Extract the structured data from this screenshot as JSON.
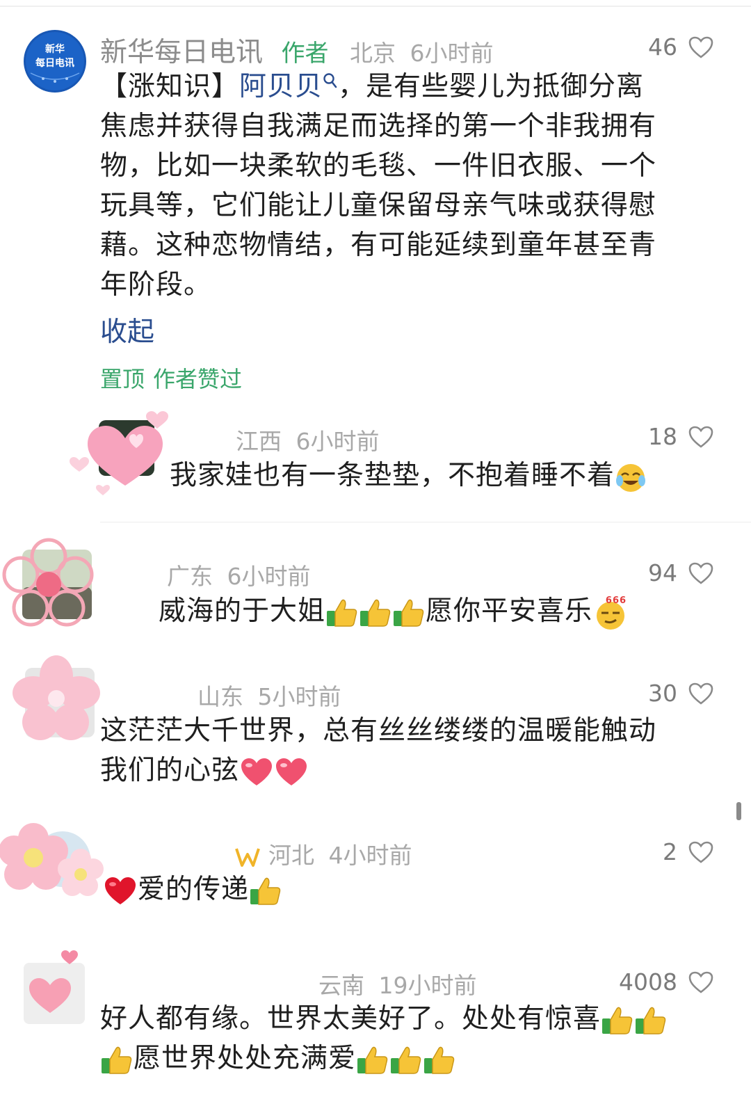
{
  "comments": [
    {
      "name": "新华每日电讯",
      "author_tag": "作者",
      "location": "北京",
      "time": "6小时前",
      "likes": "46",
      "text_prefix": "【涨知识】",
      "link_text": "阿贝贝",
      "text_l1_rest": "，是有些婴儿为抵御分离",
      "text_l2": "焦虑并获得自我满足而选择的第一个非我拥有",
      "text_l3": "物，比如一块柔软的毛毯、一件旧衣服、一个",
      "text_l4": "玩具等，它们能让儿童保留母亲气味或获得慰",
      "text_l5": "藉。这种恋物情结，有可能延续到童年甚至青",
      "text_l6": "年阶段。",
      "collapse_label": "收起",
      "tag_pinned": "置顶",
      "tag_liked": "作者赞过",
      "avatar_text_1": "新华",
      "avatar_text_2": "每日电讯"
    },
    {
      "location": "江西",
      "time": "6小时前",
      "likes": "18",
      "text": "我家娃也有一条垫垫，不抱着睡不着"
    },
    {
      "location": "广东",
      "time": "6小时前",
      "likes": "94",
      "text_a": "威海的于大姐",
      "text_b": "愿你平安喜乐",
      "badge_666": "666"
    },
    {
      "location": "山东",
      "time": "5小时前",
      "likes": "30",
      "text_l1": "这茫茫大千世界，总有丝丝缕缕的温暖能触动",
      "text_l2": "我们的心弦"
    },
    {
      "location": "河北",
      "time": "4小时前",
      "likes": "2",
      "text": "爱的传递"
    },
    {
      "location": "云南",
      "time": "19小时前",
      "likes": "4008",
      "text_l1": "好人都有缘。世界太美好了。处处有惊喜",
      "text_l2": "愿世界处处充满爱"
    }
  ],
  "icons": {
    "like": "heart-outline-icon",
    "search": "search-icon",
    "thumbs_up": "thumbs-up-emoji",
    "love": "red-heart-emoji"
  },
  "colors": {
    "author_tag": "#3aa66b",
    "link": "#2a4d8f",
    "meta": "#a8a8a8"
  }
}
